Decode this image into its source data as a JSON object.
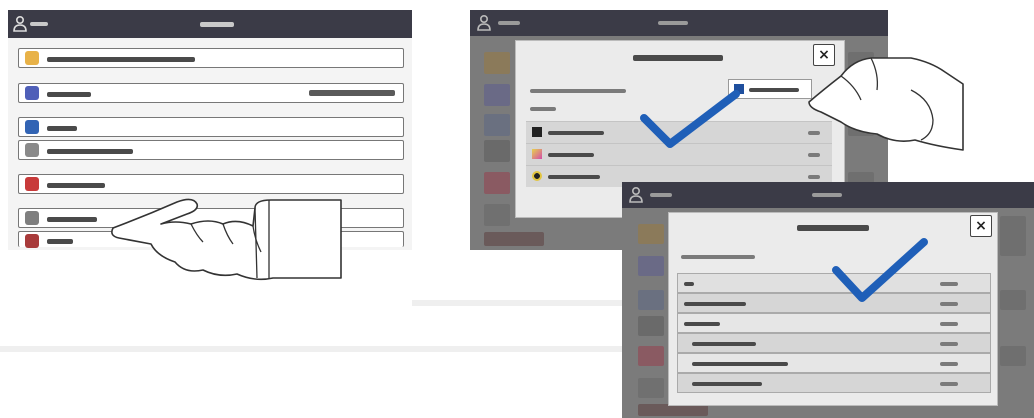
{
  "panel1": {
    "user_icon": "person-icon",
    "rows": [
      {
        "icon": "app-icon-yellow",
        "color": "#e8b248"
      },
      {
        "icon": "app-icon-blue",
        "color": "#4f5fb8"
      },
      {
        "icon": "app-icon-blue-square",
        "color": "#3264b4"
      },
      {
        "icon": "app-icon-gray",
        "color": "#8a8a8a"
      },
      {
        "icon": "app-icon-red",
        "color": "#c83a3a"
      },
      {
        "icon": "app-icon-gray-doc",
        "color": "#7f7f7f"
      },
      {
        "icon": "app-icon-red-doc",
        "color": "#a83a3a"
      }
    ]
  },
  "panel2": {
    "close_glyph": "×",
    "check_icon": "checkmark-icon",
    "list_icons": [
      "black-swatch-icon",
      "multicolor-swatch-icon",
      "color-swatch-icon"
    ]
  },
  "panel3": {
    "close_glyph": "×",
    "check_icon": "checkmark-icon"
  },
  "colors": {
    "check_blue": "#1f5fb8",
    "title_bar": "#3b3b47",
    "modal_bg": "#e8e8e8"
  }
}
